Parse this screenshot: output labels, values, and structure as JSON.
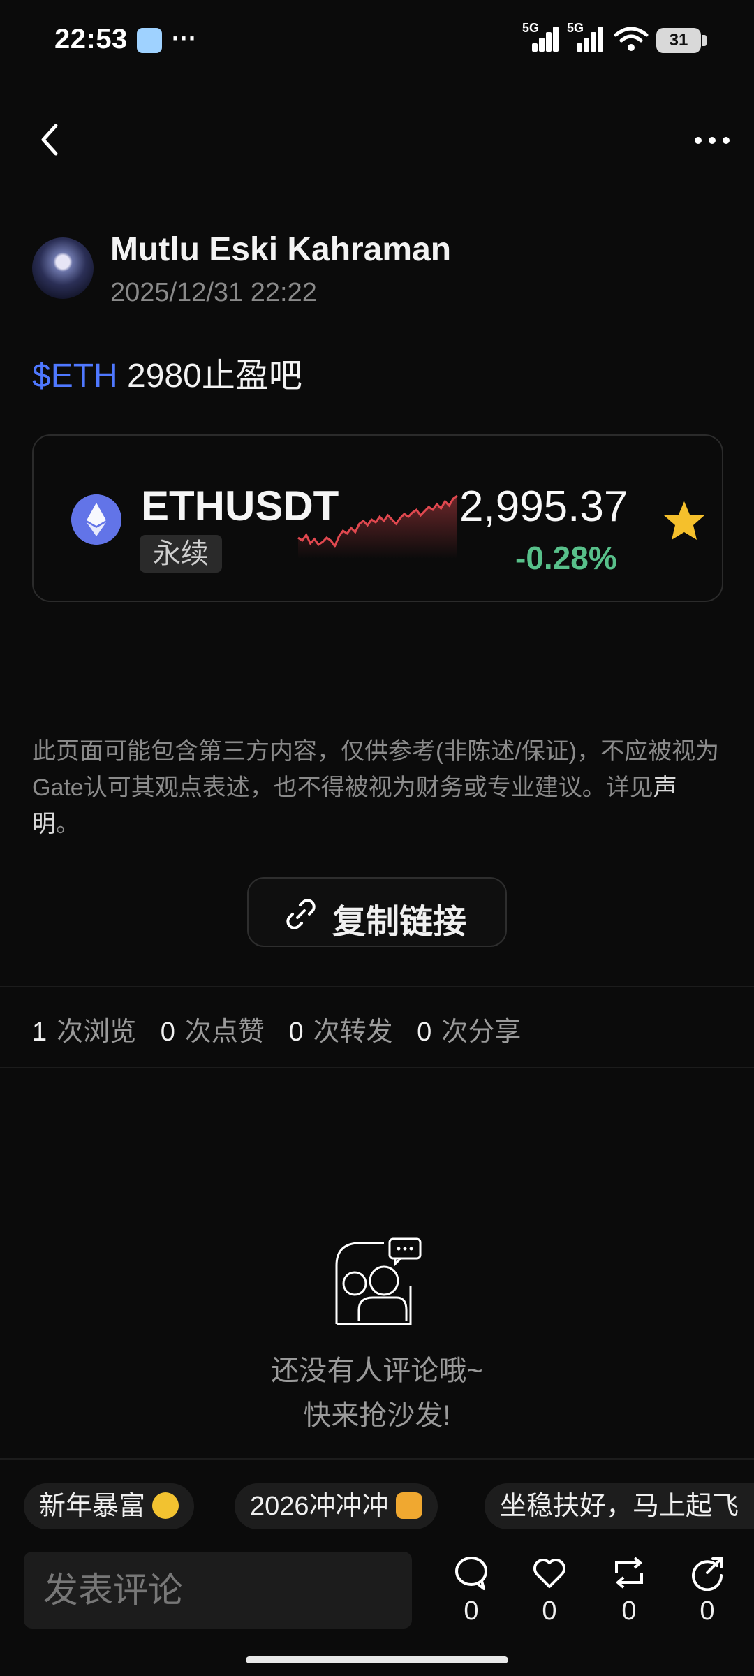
{
  "status_bar": {
    "time": "22:53",
    "dots": "···",
    "network1": "5G",
    "network2": "5G",
    "battery": "31"
  },
  "author": {
    "name": "Mutlu Eski Kahraman",
    "time": "2025/12/31 22:22"
  },
  "post": {
    "tag": "$ETH",
    "text": " 2980止盈吧"
  },
  "ticker": {
    "symbol": "ETHUSDT",
    "type": "永续",
    "price": "2,995.37",
    "change": "-0.28%",
    "favorited": true
  },
  "disclaimer": {
    "text": "此页面可能包含第三方内容，仅供参考(非陈述/保证)，不应被视为Gate认可其观点表述，也不得被视为财务或专业建议。详见",
    "link": "声明",
    "end": "。"
  },
  "copy_link": "复制链接",
  "stats": [
    {
      "num": "1",
      "label": "次浏览"
    },
    {
      "num": "0",
      "label": "次点赞"
    },
    {
      "num": "0",
      "label": "次转发"
    },
    {
      "num": "0",
      "label": "次分享"
    }
  ],
  "empty": {
    "line1": "还没有人评论哦~",
    "line2": "快来抢沙发!"
  },
  "chips": [
    {
      "label": "新年暴富",
      "emoji": "money-face"
    },
    {
      "label": "2026冲冲冲",
      "emoji": "fist"
    },
    {
      "label": "坐稳扶好，马上起飞"
    }
  ],
  "comment_placeholder": "发表评论",
  "actions": [
    {
      "name": "comment",
      "count": "0"
    },
    {
      "name": "like",
      "count": "0"
    },
    {
      "name": "repost",
      "count": "0"
    },
    {
      "name": "share",
      "count": "0"
    }
  ],
  "colors": {
    "accent_blue": "#4f78ff",
    "positive_green": "#58c08a",
    "star_yellow": "#f5c02c",
    "spark_red": "#e0484f"
  }
}
